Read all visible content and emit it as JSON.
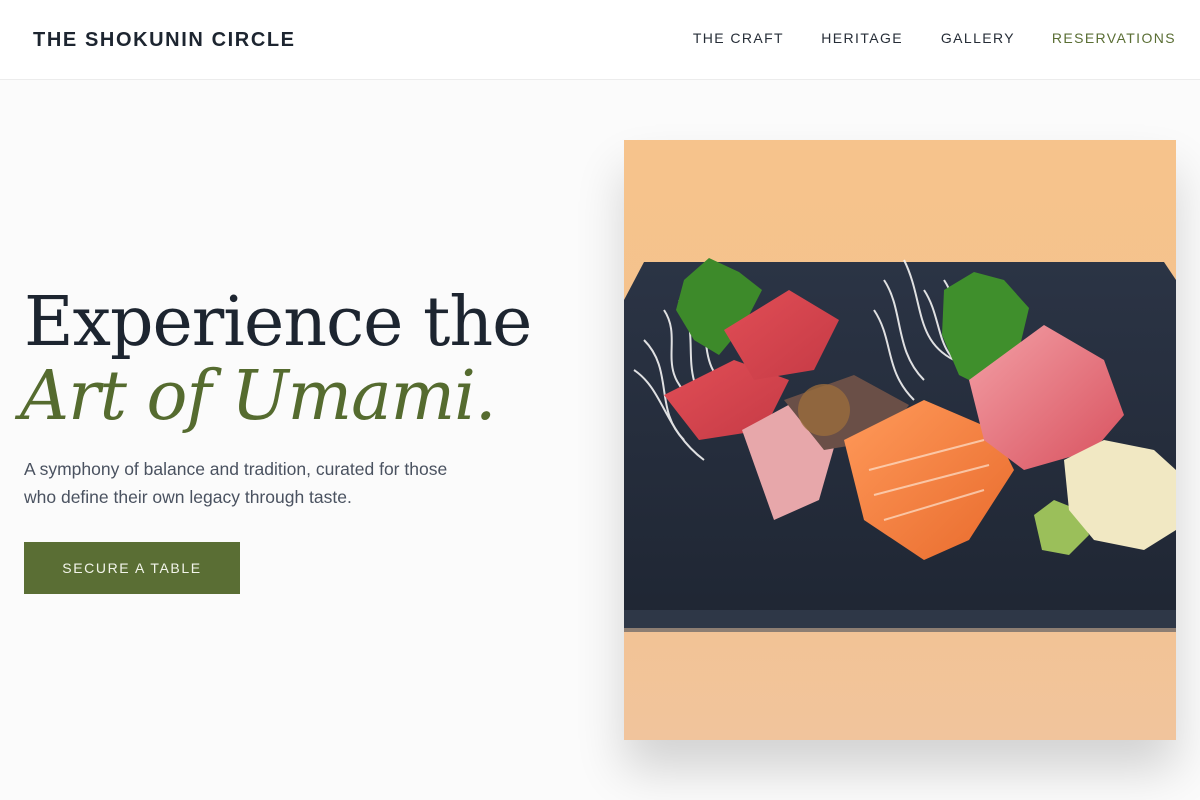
{
  "header": {
    "brand": "THE SHOKUNIN CIRCLE",
    "nav": [
      {
        "label": "THE CRAFT"
      },
      {
        "label": "HERITAGE"
      },
      {
        "label": "GALLERY"
      },
      {
        "label": "RESERVATIONS",
        "active": true
      }
    ]
  },
  "hero": {
    "title_line1": "Experience the",
    "title_line2": "Art of Umami.",
    "subtitle": "A symphony of balance and tradition, curated for those who define their own legacy through taste.",
    "cta_label": "SECURE A TABLE"
  },
  "colors": {
    "accent": "#5a6e34",
    "text_dark": "#1d2530",
    "text_muted": "#4a5260",
    "background": "#fbfbfb"
  }
}
